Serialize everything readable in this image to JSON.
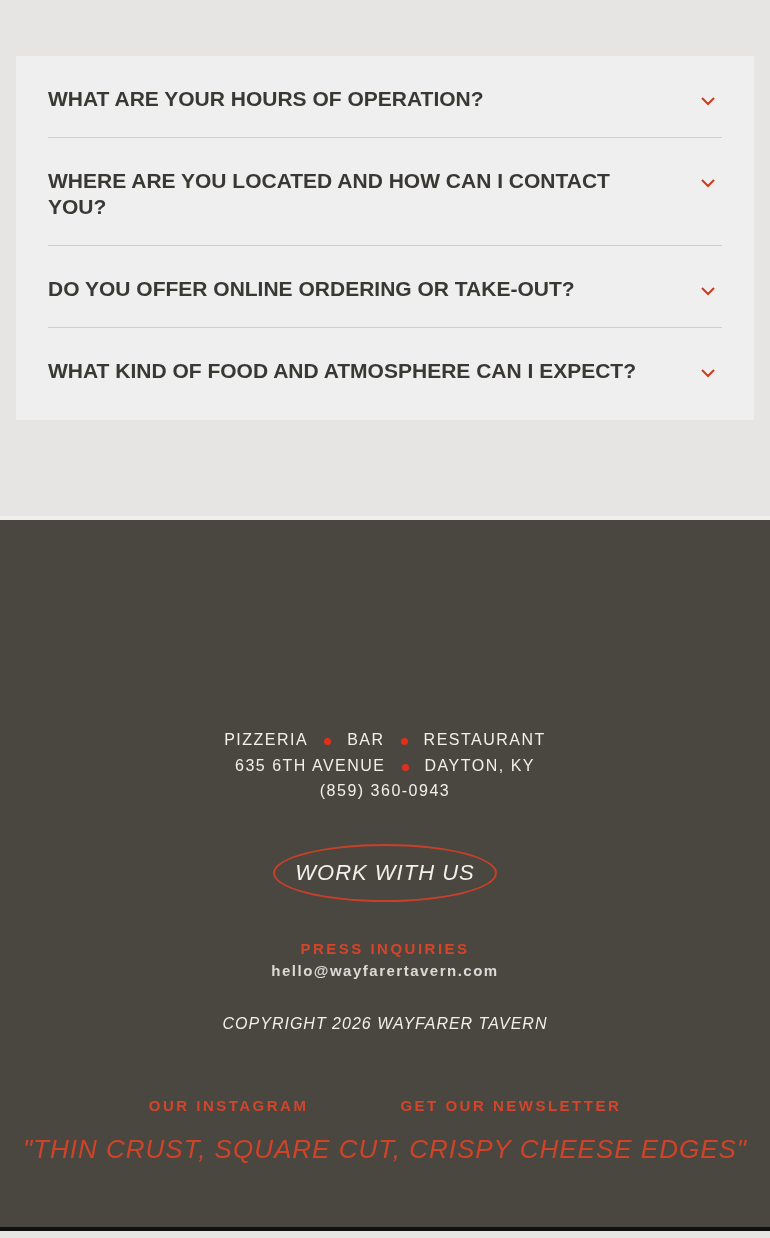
{
  "faq": [
    {
      "question": "WHAT ARE YOUR HOURS OF OPERATION?",
      "expanded": false
    },
    {
      "question": "WHERE ARE YOU LOCATED AND HOW CAN I CONTACT YOU?",
      "expanded": false
    },
    {
      "question": "DO YOU OFFER ONLINE ORDERING OR TAKE-OUT?",
      "expanded": false
    },
    {
      "question": "WHAT KIND OF FOOD AND ATMOSPHERE CAN I EXPECT?",
      "expanded": false
    }
  ],
  "footer": {
    "info_lines": [
      [
        "PIZZERIA",
        "BAR",
        "RESTAURANT"
      ],
      [
        "635 6TH AVENUE",
        "DAYTON, KY"
      ],
      [
        "(859) 360-0943"
      ]
    ],
    "work_button": "WORK WITH US",
    "press_label": "PRESS INQUIRIES",
    "email": "hello@wayfarertavern.com",
    "copyright": "COPYRIGHT 2026 WAYFARER TAVERN",
    "links": [
      "OUR INSTAGRAM",
      "GET OUR NEWSLETTER"
    ],
    "quote": "\"THIN CRUST, SQUARE CUT, CRISPY CHEESE EDGES\""
  }
}
